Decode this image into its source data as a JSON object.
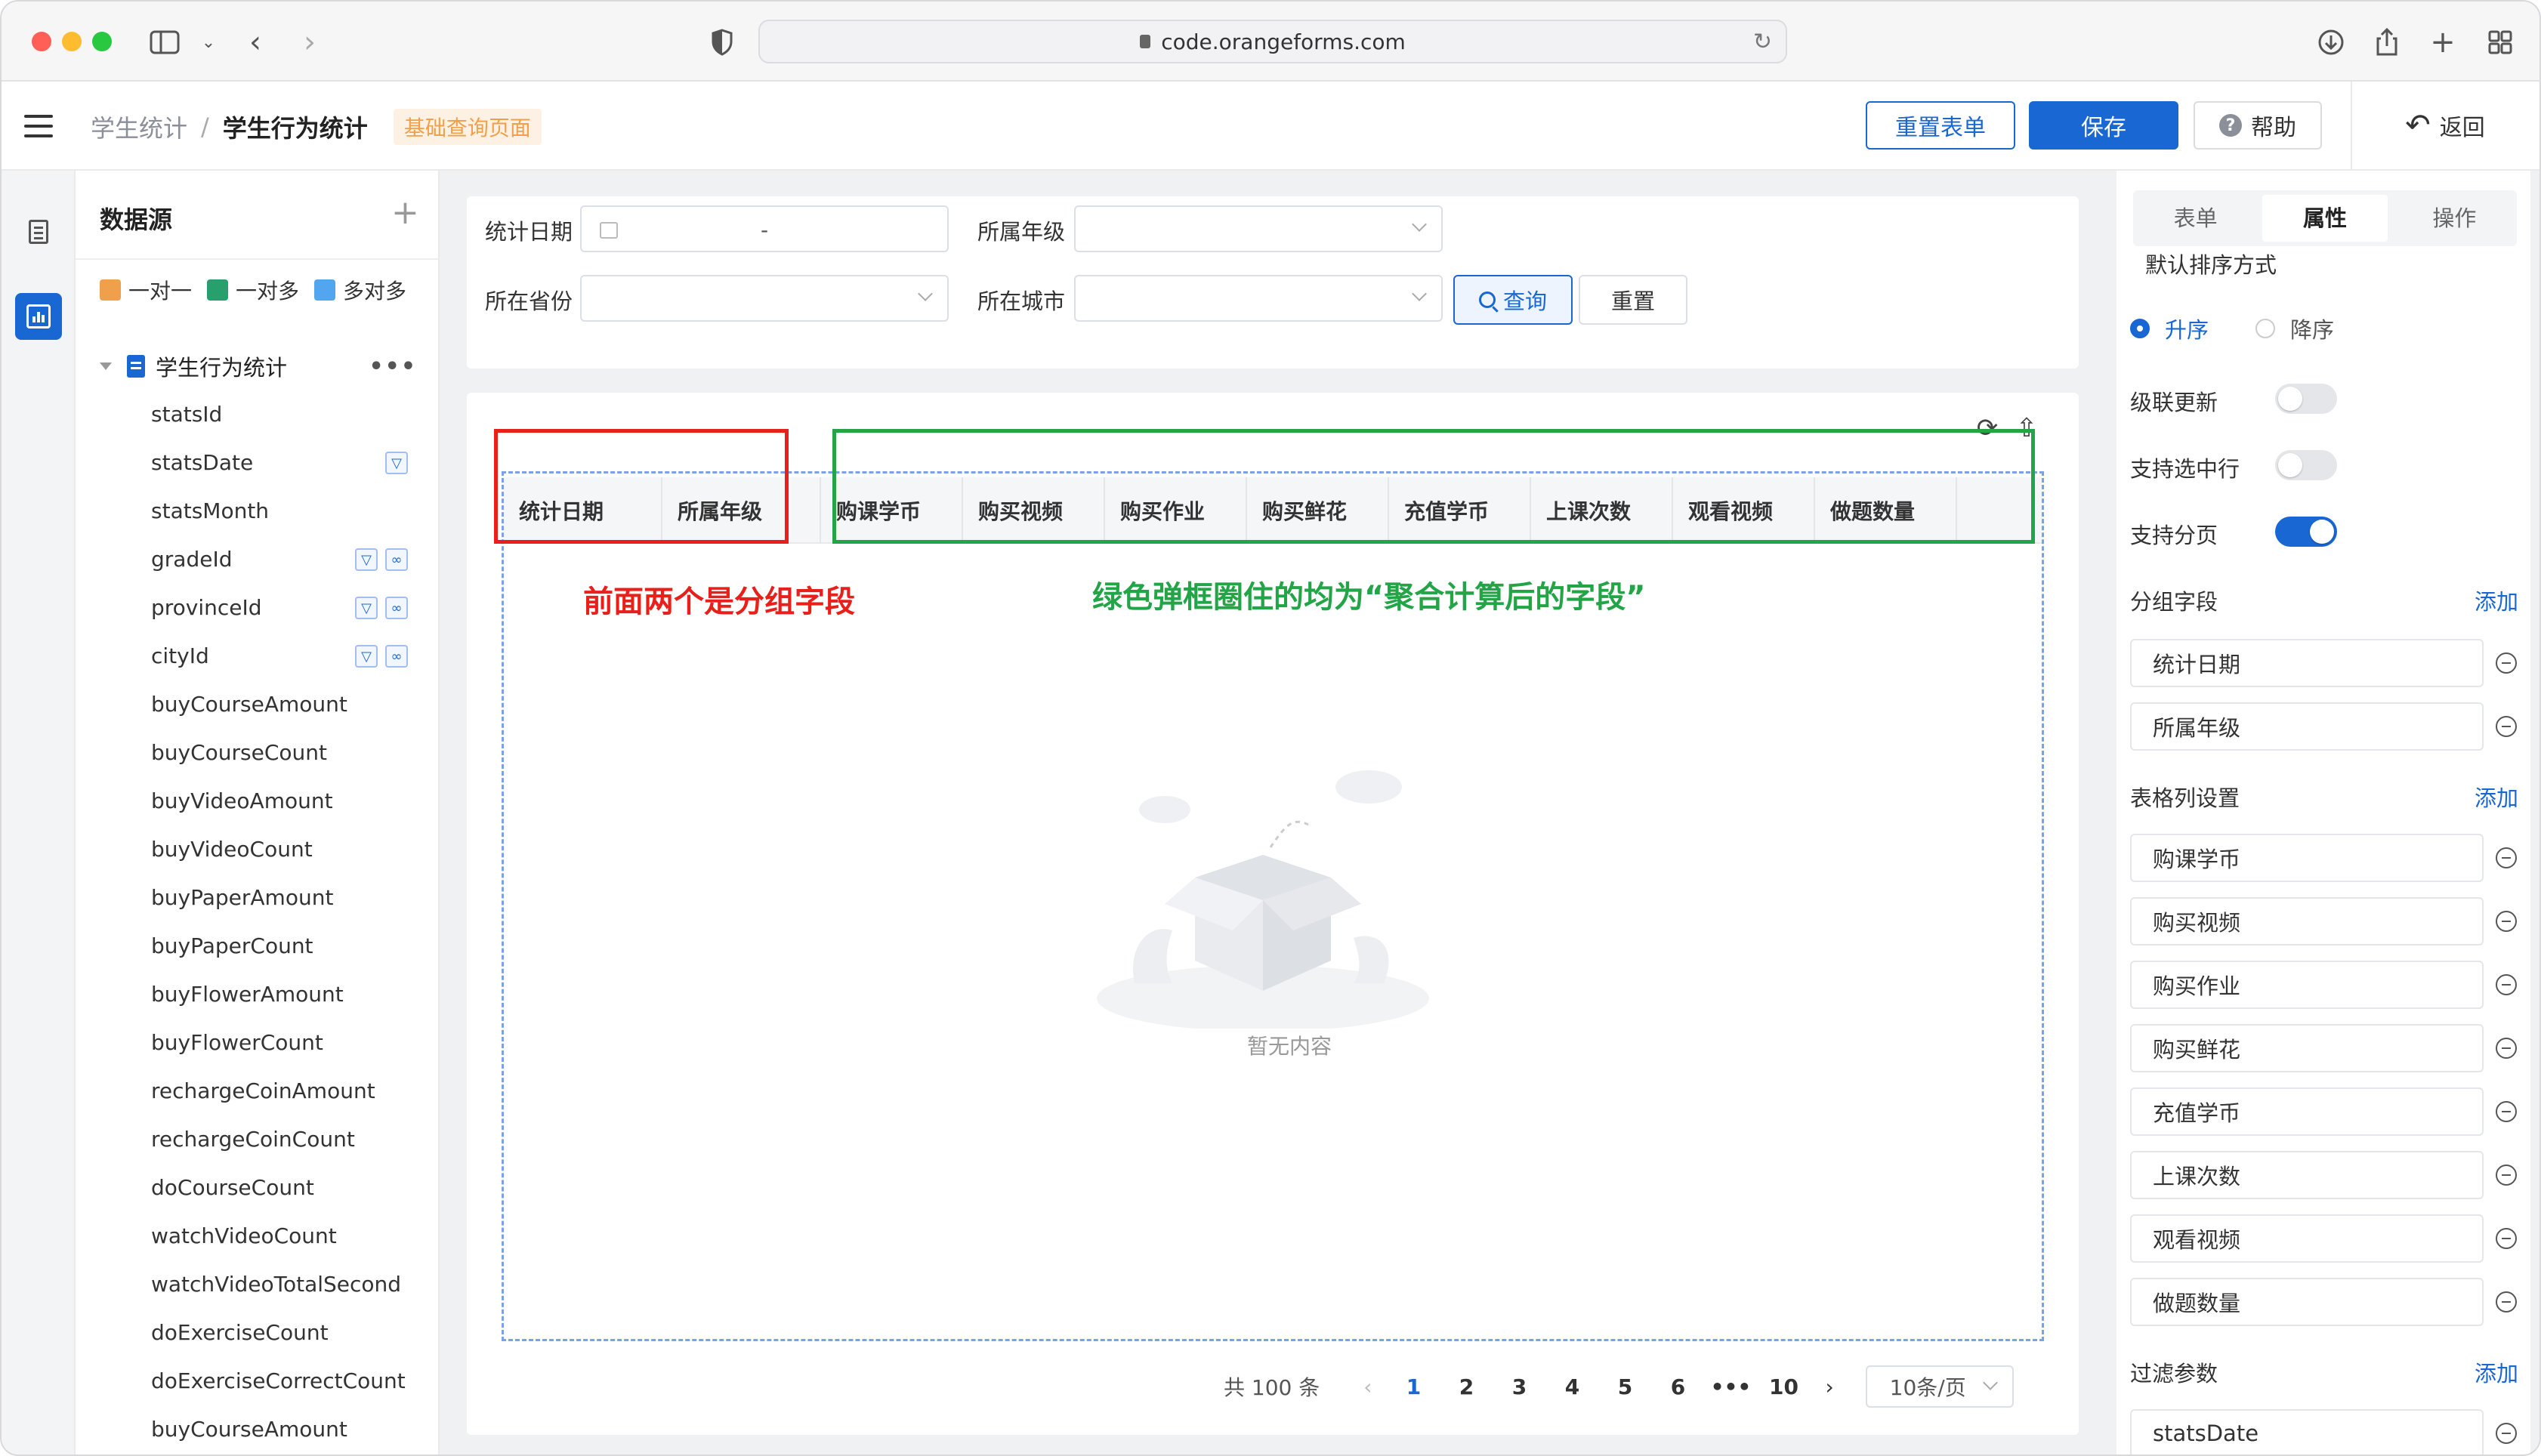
{
  "browser": {
    "url": "code.orangeforms.com"
  },
  "header": {
    "breadcrumb_parent": "学生统计",
    "breadcrumb_sep": "/",
    "breadcrumb_current": "学生行为统计",
    "page_tag": "基础查询页面",
    "reset_form_label": "重置表单",
    "save_label": "保存",
    "help_label": "帮助",
    "back_label": "返回"
  },
  "datasource": {
    "title": "数据源",
    "legend": [
      "一对一",
      "一对多",
      "多对多"
    ],
    "root": "学生行为统计",
    "root_more": "•••",
    "fields": [
      {
        "name": "statsId",
        "badges": []
      },
      {
        "name": "statsDate",
        "badges": [
          "filter"
        ]
      },
      {
        "name": "statsMonth",
        "badges": []
      },
      {
        "name": "gradeId",
        "badges": [
          "filter",
          "dict"
        ]
      },
      {
        "name": "provinceId",
        "badges": [
          "filter",
          "dict"
        ]
      },
      {
        "name": "cityId",
        "badges": [
          "filter",
          "dict"
        ]
      },
      {
        "name": "buyCourseAmount",
        "badges": []
      },
      {
        "name": "buyCourseCount",
        "badges": []
      },
      {
        "name": "buyVideoAmount",
        "badges": []
      },
      {
        "name": "buyVideoCount",
        "badges": []
      },
      {
        "name": "buyPaperAmount",
        "badges": []
      },
      {
        "name": "buyPaperCount",
        "badges": []
      },
      {
        "name": "buyFlowerAmount",
        "badges": []
      },
      {
        "name": "buyFlowerCount",
        "badges": []
      },
      {
        "name": "rechargeCoinAmount",
        "badges": []
      },
      {
        "name": "rechargeCoinCount",
        "badges": []
      },
      {
        "name": "doCourseCount",
        "badges": []
      },
      {
        "name": "watchVideoCount",
        "badges": []
      },
      {
        "name": "watchVideoTotalSecond",
        "badges": []
      },
      {
        "name": "doExerciseCount",
        "badges": []
      },
      {
        "name": "doExerciseCorrectCount",
        "badges": []
      },
      {
        "name": "buyCourseAmount",
        "badges": []
      }
    ]
  },
  "filters": {
    "stats_date_label": "统计日期",
    "date_range_sep": "-",
    "grade_label": "所属年级",
    "province_label": "所在省份",
    "city_label": "所在城市",
    "query_label": "查询",
    "reset_label": "重置"
  },
  "table": {
    "group_columns": [
      "统计日期",
      "所属年级"
    ],
    "agg_columns": [
      "购课学币",
      "购买视频",
      "购买作业",
      "购买鲜花",
      "充值学币",
      "上课次数",
      "观看视频",
      "做题数量"
    ],
    "empty_text": "暂无内容"
  },
  "annotations": {
    "red_note": "前面两个是分组字段",
    "green_note": "绿色弹框圈住的均为“聚合计算后的字段”"
  },
  "pager": {
    "total": "共 100 条",
    "pages": [
      "1",
      "2",
      "3",
      "4",
      "5",
      "6",
      "•••",
      "10"
    ],
    "active_page": "1",
    "page_size": "10条/页"
  },
  "props": {
    "tabs": [
      "表单",
      "属性",
      "操作"
    ],
    "active_tab": "属性",
    "sort_label": "默认排序方式",
    "sort_asc": "升序",
    "sort_desc": "降序",
    "cascade_label": "级联更新",
    "cascade_on": false,
    "select_row_label": "支持选中行",
    "select_row_on": false,
    "paging_label": "支持分页",
    "paging_on": true,
    "group_fields_label": "分组字段",
    "add_label": "添加",
    "group_fields": [
      "统计日期",
      "所属年级"
    ],
    "columns_label": "表格列设置",
    "columns": [
      "购课学币",
      "购买视频",
      "购买作业",
      "购买鲜花",
      "充值学币",
      "上课次数",
      "观看视频",
      "做题数量"
    ],
    "filter_params_label": "过滤参数",
    "filter_params": [
      "statsDate"
    ]
  },
  "colors": {
    "primary": "#1967d2",
    "annotation_red": "#e8201b",
    "annotation_green": "#22a447",
    "tag_orange": "#f0a04b"
  }
}
